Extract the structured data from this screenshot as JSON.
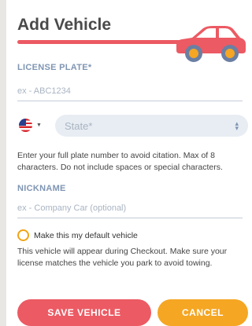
{
  "header": {
    "title": "Add Vehicle",
    "car_icon": "car-icon",
    "accent_color": "#ec5a63"
  },
  "license_plate": {
    "label": "LICENSE PLATE*",
    "placeholder": "ex - ABC1234",
    "value": ""
  },
  "state": {
    "flag_icon": "us-flag-icon",
    "placeholder": "State*",
    "value": ""
  },
  "plate_helper": "Enter your full plate number to avoid citation. Max of 8 characters. Do not include spaces or special characters.",
  "nickname": {
    "label": "NICKNAME",
    "placeholder": "ex - Company Car (optional)",
    "value": ""
  },
  "default_vehicle": {
    "label": "Make this my default vehicle",
    "checked": false,
    "radio_color": "#f0a413"
  },
  "checkout_helper": "This vehicle will appear during Checkout. Make sure your license matches the vehicle you park to avoid towing.",
  "buttons": {
    "save_label": "SAVE VEHICLE",
    "save_color": "#ec5a63",
    "cancel_label": "CANCEL",
    "cancel_color": "#f5a623"
  }
}
